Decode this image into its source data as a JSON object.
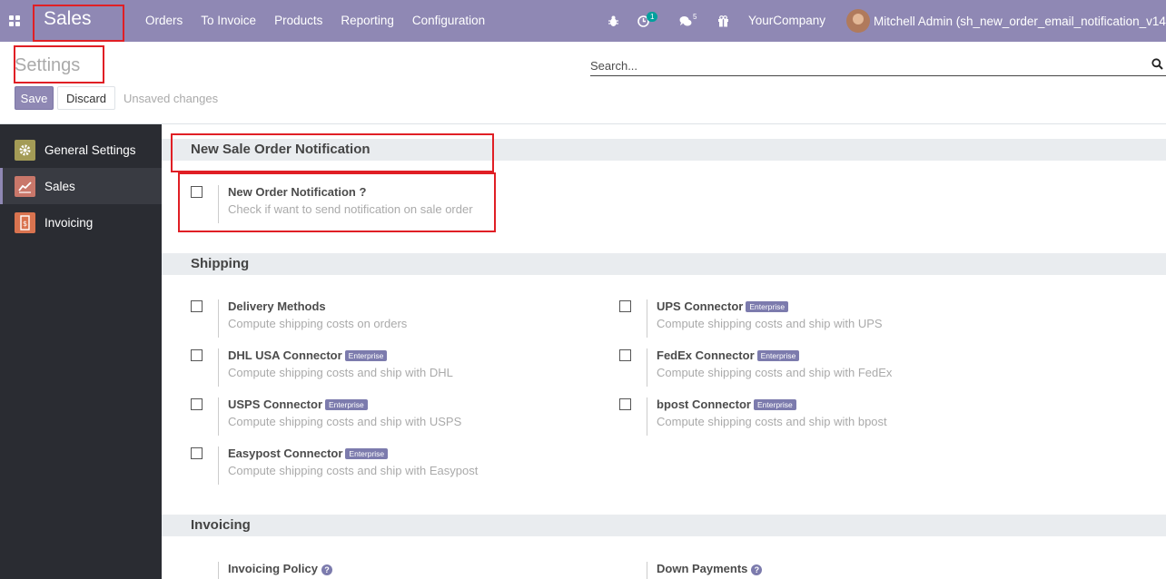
{
  "navbar": {
    "apps_icon": "apps-grid-icon",
    "brand": "Sales",
    "menu": [
      "Orders",
      "To Invoice",
      "Products",
      "Reporting",
      "Configuration"
    ],
    "activities_count": "1",
    "messages_count": "5",
    "company": "YourCompany",
    "user": "Mitchell Admin (sh_new_order_email_notification_v14c)"
  },
  "control_panel": {
    "title": "Settings",
    "search_placeholder": "Search...",
    "save_label": "Save",
    "discard_label": "Discard",
    "unsaved_text": "Unsaved changes"
  },
  "sidebar": {
    "items": [
      {
        "label": "General Settings",
        "icon": "gear-icon",
        "color": "#a39b56"
      },
      {
        "label": "Sales",
        "icon": "chart-line-icon",
        "color": "#c9776a"
      },
      {
        "label": "Invoicing",
        "icon": "invoice-icon",
        "color": "#d9734f"
      }
    ]
  },
  "sections": {
    "notification": {
      "title": "New Sale Order Notification",
      "setting": {
        "label": "New Order Notification ?",
        "desc": "Check if want to send notification on sale order"
      }
    },
    "shipping": {
      "title": "Shipping",
      "settings": [
        {
          "label": "Delivery Methods",
          "desc": "Compute shipping costs on orders",
          "badge": ""
        },
        {
          "label": "UPS Connector",
          "desc": "Compute shipping costs and ship with UPS",
          "badge": "Enterprise"
        },
        {
          "label": "DHL USA Connector",
          "desc": "Compute shipping costs and ship with DHL",
          "badge": "Enterprise"
        },
        {
          "label": "FedEx Connector",
          "desc": "Compute shipping costs and ship with FedEx",
          "badge": "Enterprise"
        },
        {
          "label": "USPS Connector",
          "desc": "Compute shipping costs and ship with USPS",
          "badge": "Enterprise"
        },
        {
          "label": "bpost Connector",
          "desc": "Compute shipping costs and ship with bpost",
          "badge": "Enterprise"
        },
        {
          "label": "Easypost Connector",
          "desc": "Compute shipping costs and ship with Easypost",
          "badge": "Enterprise"
        }
      ]
    },
    "invoicing": {
      "title": "Invoicing",
      "settings": [
        {
          "label": "Invoicing Policy",
          "help": "?"
        },
        {
          "label": "Down Payments",
          "help": "?"
        }
      ]
    }
  },
  "colors": {
    "navbar": "#8f88b4",
    "sidebar": "#2a2c32",
    "annotation_red": "#e01f25"
  }
}
